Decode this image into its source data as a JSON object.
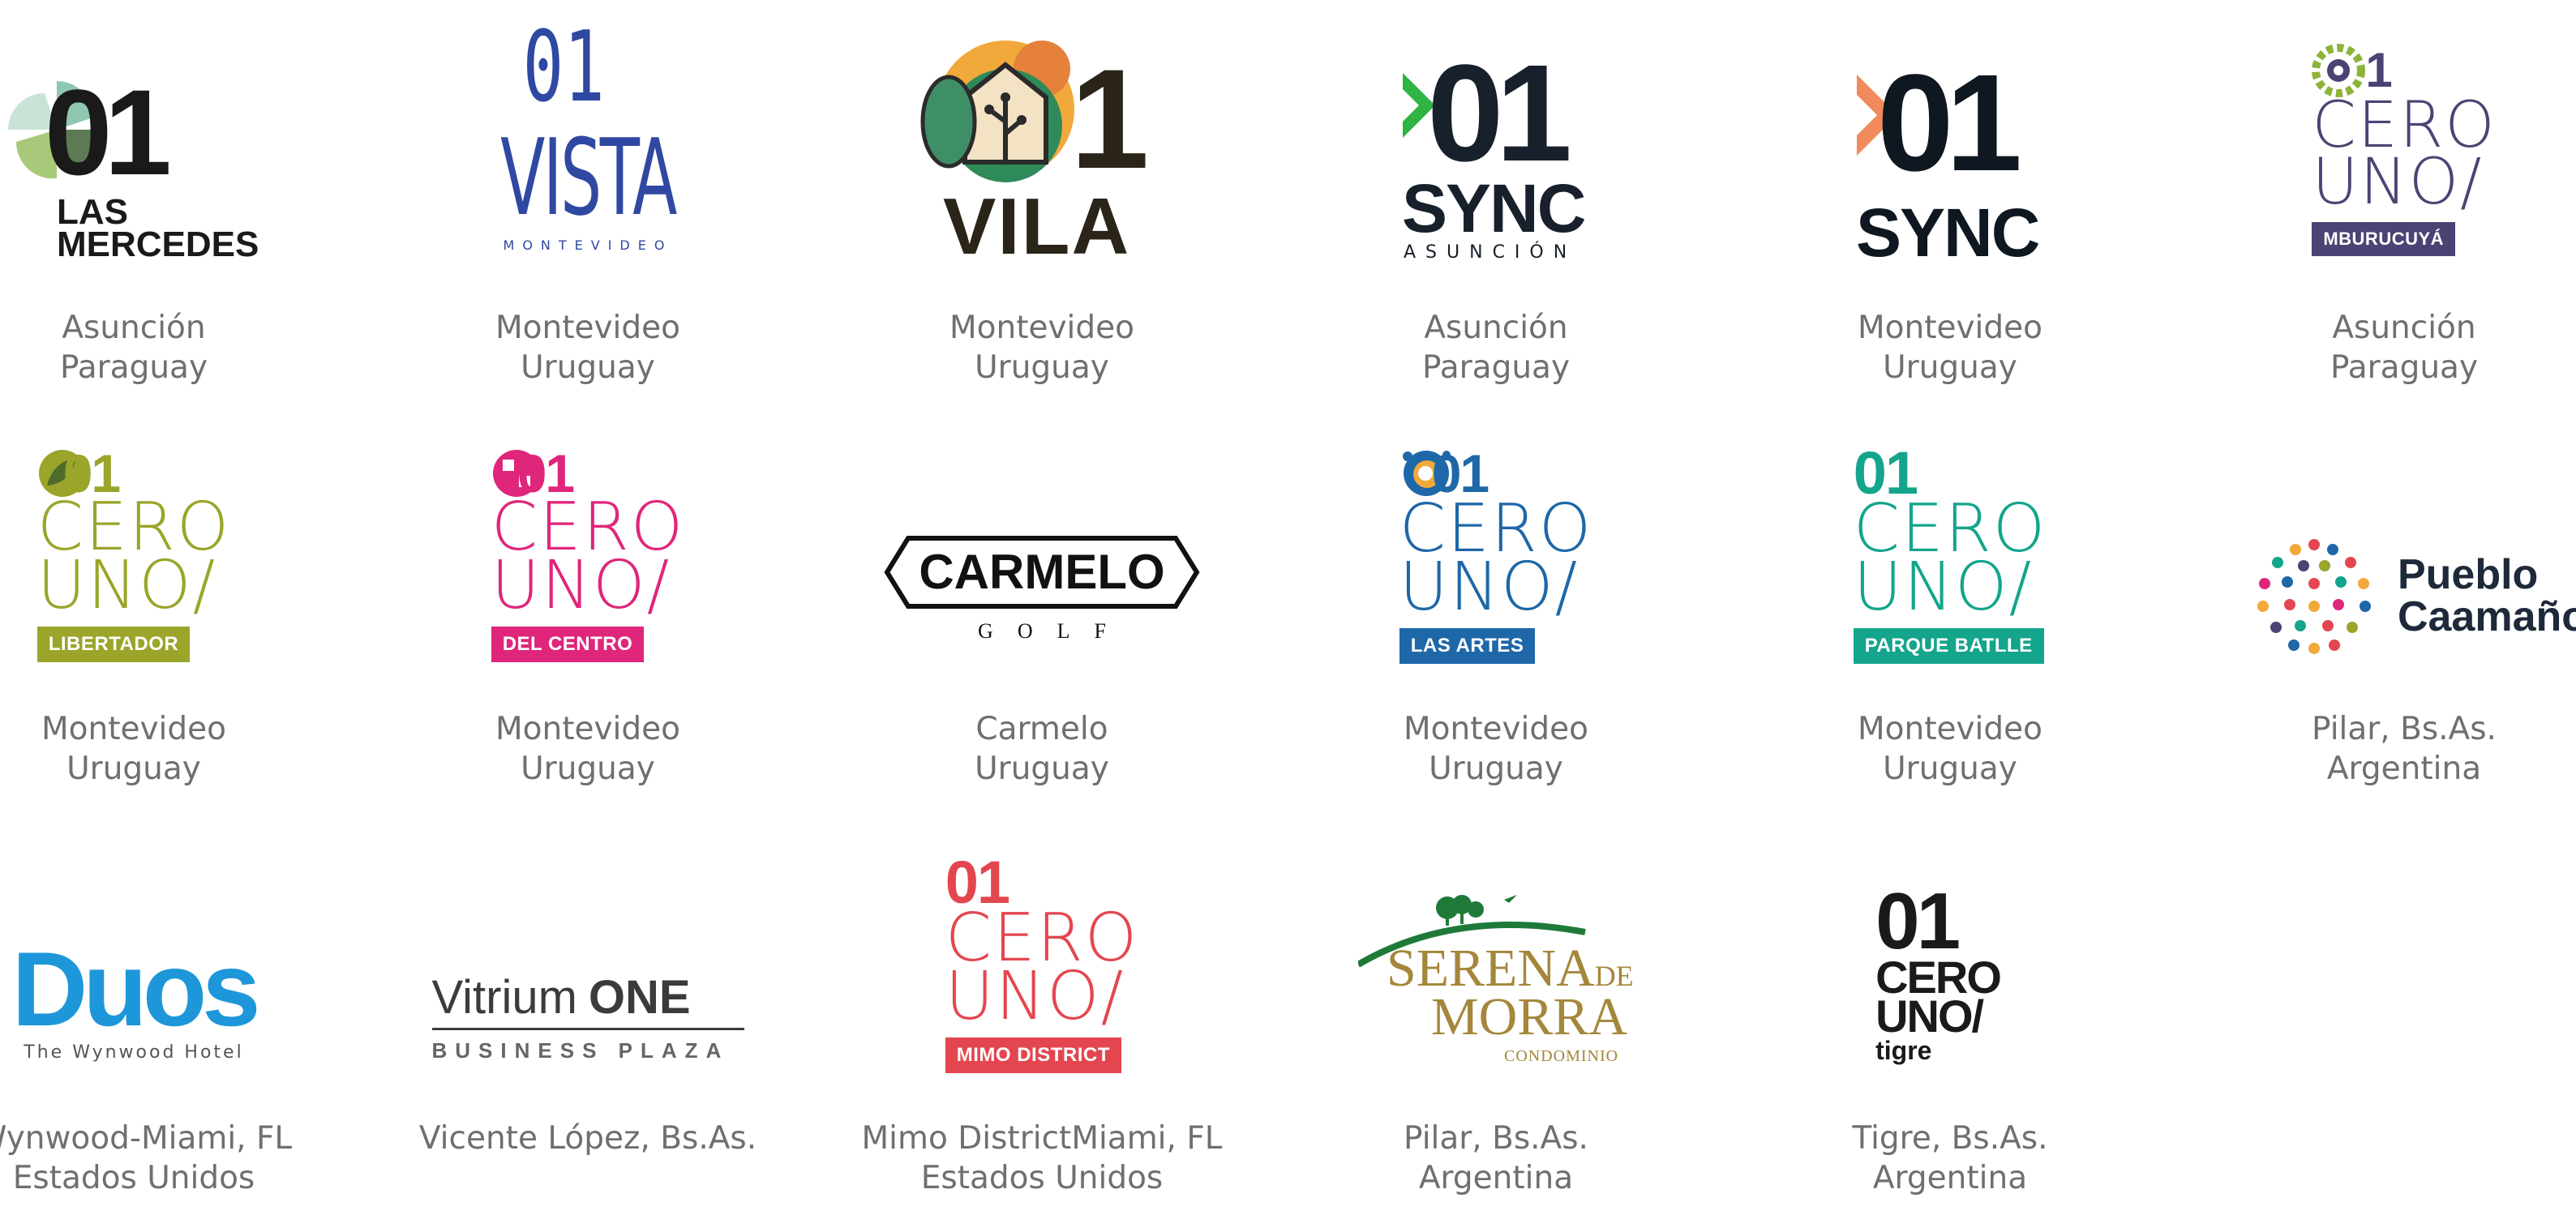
{
  "colors": {
    "caption": "#6f6f6f",
    "dark": "#1a1a1a",
    "vista_blue": "#2f48a2",
    "sync_green": "#2fb343",
    "sync_orange": "#f08a5d",
    "mburucuya": "#4a4475",
    "libertador": "#9aa52a",
    "del_centro": "#e0267b",
    "las_artes": "#1e67a8",
    "parque_batlle": "#14a58c",
    "mimo": "#e4464f",
    "duos": "#1d97d9",
    "serena": "#a4873b"
  },
  "items": [
    {
      "logo": {
        "l1": "01",
        "l2": "LAS",
        "l3": "MERCEDES"
      },
      "city": "Asunción",
      "country": "Paraguay"
    },
    {
      "logo": {
        "l1": "01",
        "l2": "VISTA",
        "l3": "MONTEVIDEO"
      },
      "city": "Montevideo",
      "country": "Uruguay"
    },
    {
      "logo": {
        "l1": "1",
        "l2": "VILA"
      },
      "city": "Montevideo",
      "country": "Uruguay"
    },
    {
      "logo": {
        "l1": "01",
        "l2": "SYNC",
        "l3": "ASUNCIÓN"
      },
      "city": "Asunción",
      "country": "Paraguay"
    },
    {
      "logo": {
        "l1": "01",
        "l2": "SYNC"
      },
      "city": "Montevideo",
      "country": "Uruguay"
    },
    {
      "logo": {
        "l1": "1",
        "l2": "CERO",
        "l3": "UNO/",
        "tag": "MBURUCUYÁ"
      },
      "city": "Asunción",
      "country": "Paraguay"
    },
    {
      "logo": {
        "l1": "01",
        "l2": "CERO",
        "l3": "UNO/",
        "tag": "LIBERTADOR"
      },
      "city": "Montevideo",
      "country": "Uruguay"
    },
    {
      "logo": {
        "l1": "01",
        "l2": "CERO",
        "l3": "UNO/",
        "tag": "DEL CENTRO"
      },
      "city": "Montevideo",
      "country": "Uruguay"
    },
    {
      "logo": {
        "l1": "CARMELO",
        "l2": "GOLF"
      },
      "city": "Carmelo",
      "country": "Uruguay"
    },
    {
      "logo": {
        "l1": "01",
        "l2": "CERO",
        "l3": "UNO/",
        "tag": "LAS ARTES"
      },
      "city": "Montevideo",
      "country": "Uruguay"
    },
    {
      "logo": {
        "l1": "01",
        "l2": "CERO",
        "l3": "UNO/",
        "tag": "PARQUE BATLLE"
      },
      "city": "Montevideo",
      "country": "Uruguay"
    },
    {
      "logo": {
        "l1": "Pueblo",
        "l2": "Caamaño"
      },
      "city": "Pilar, Bs.As.",
      "country": "Argentina"
    },
    {
      "logo": {
        "l1": "Duos",
        "l2": "The Wynwood Hotel"
      },
      "city": "Wynwood-Miami, FL",
      "country": "Estados Unidos"
    },
    {
      "logo": {
        "l1": "Vitrium",
        "l1b": "ONE",
        "l2": "BUSINESS PLAZA"
      },
      "city": "Vicente López, Bs.As.",
      "country": ""
    },
    {
      "logo": {
        "l1": "01",
        "l2": "CERO",
        "l3": "UNO/",
        "tag": "MIMO DISTRICT"
      },
      "city": "Mimo DistrictMiami, FL",
      "country": "Estados Unidos"
    },
    {
      "logo": {
        "l1": "SERENA",
        "l1b": "DE",
        "l2": "MORRA",
        "l3": "CONDOMINIO"
      },
      "city": "Pilar, Bs.As.",
      "country": "Argentina"
    },
    {
      "logo": {
        "l1": "01",
        "l2": "CERO",
        "l3": "UNO/",
        "l4": "tigre"
      },
      "city": "Tigre, Bs.As.",
      "country": "Argentina"
    }
  ]
}
